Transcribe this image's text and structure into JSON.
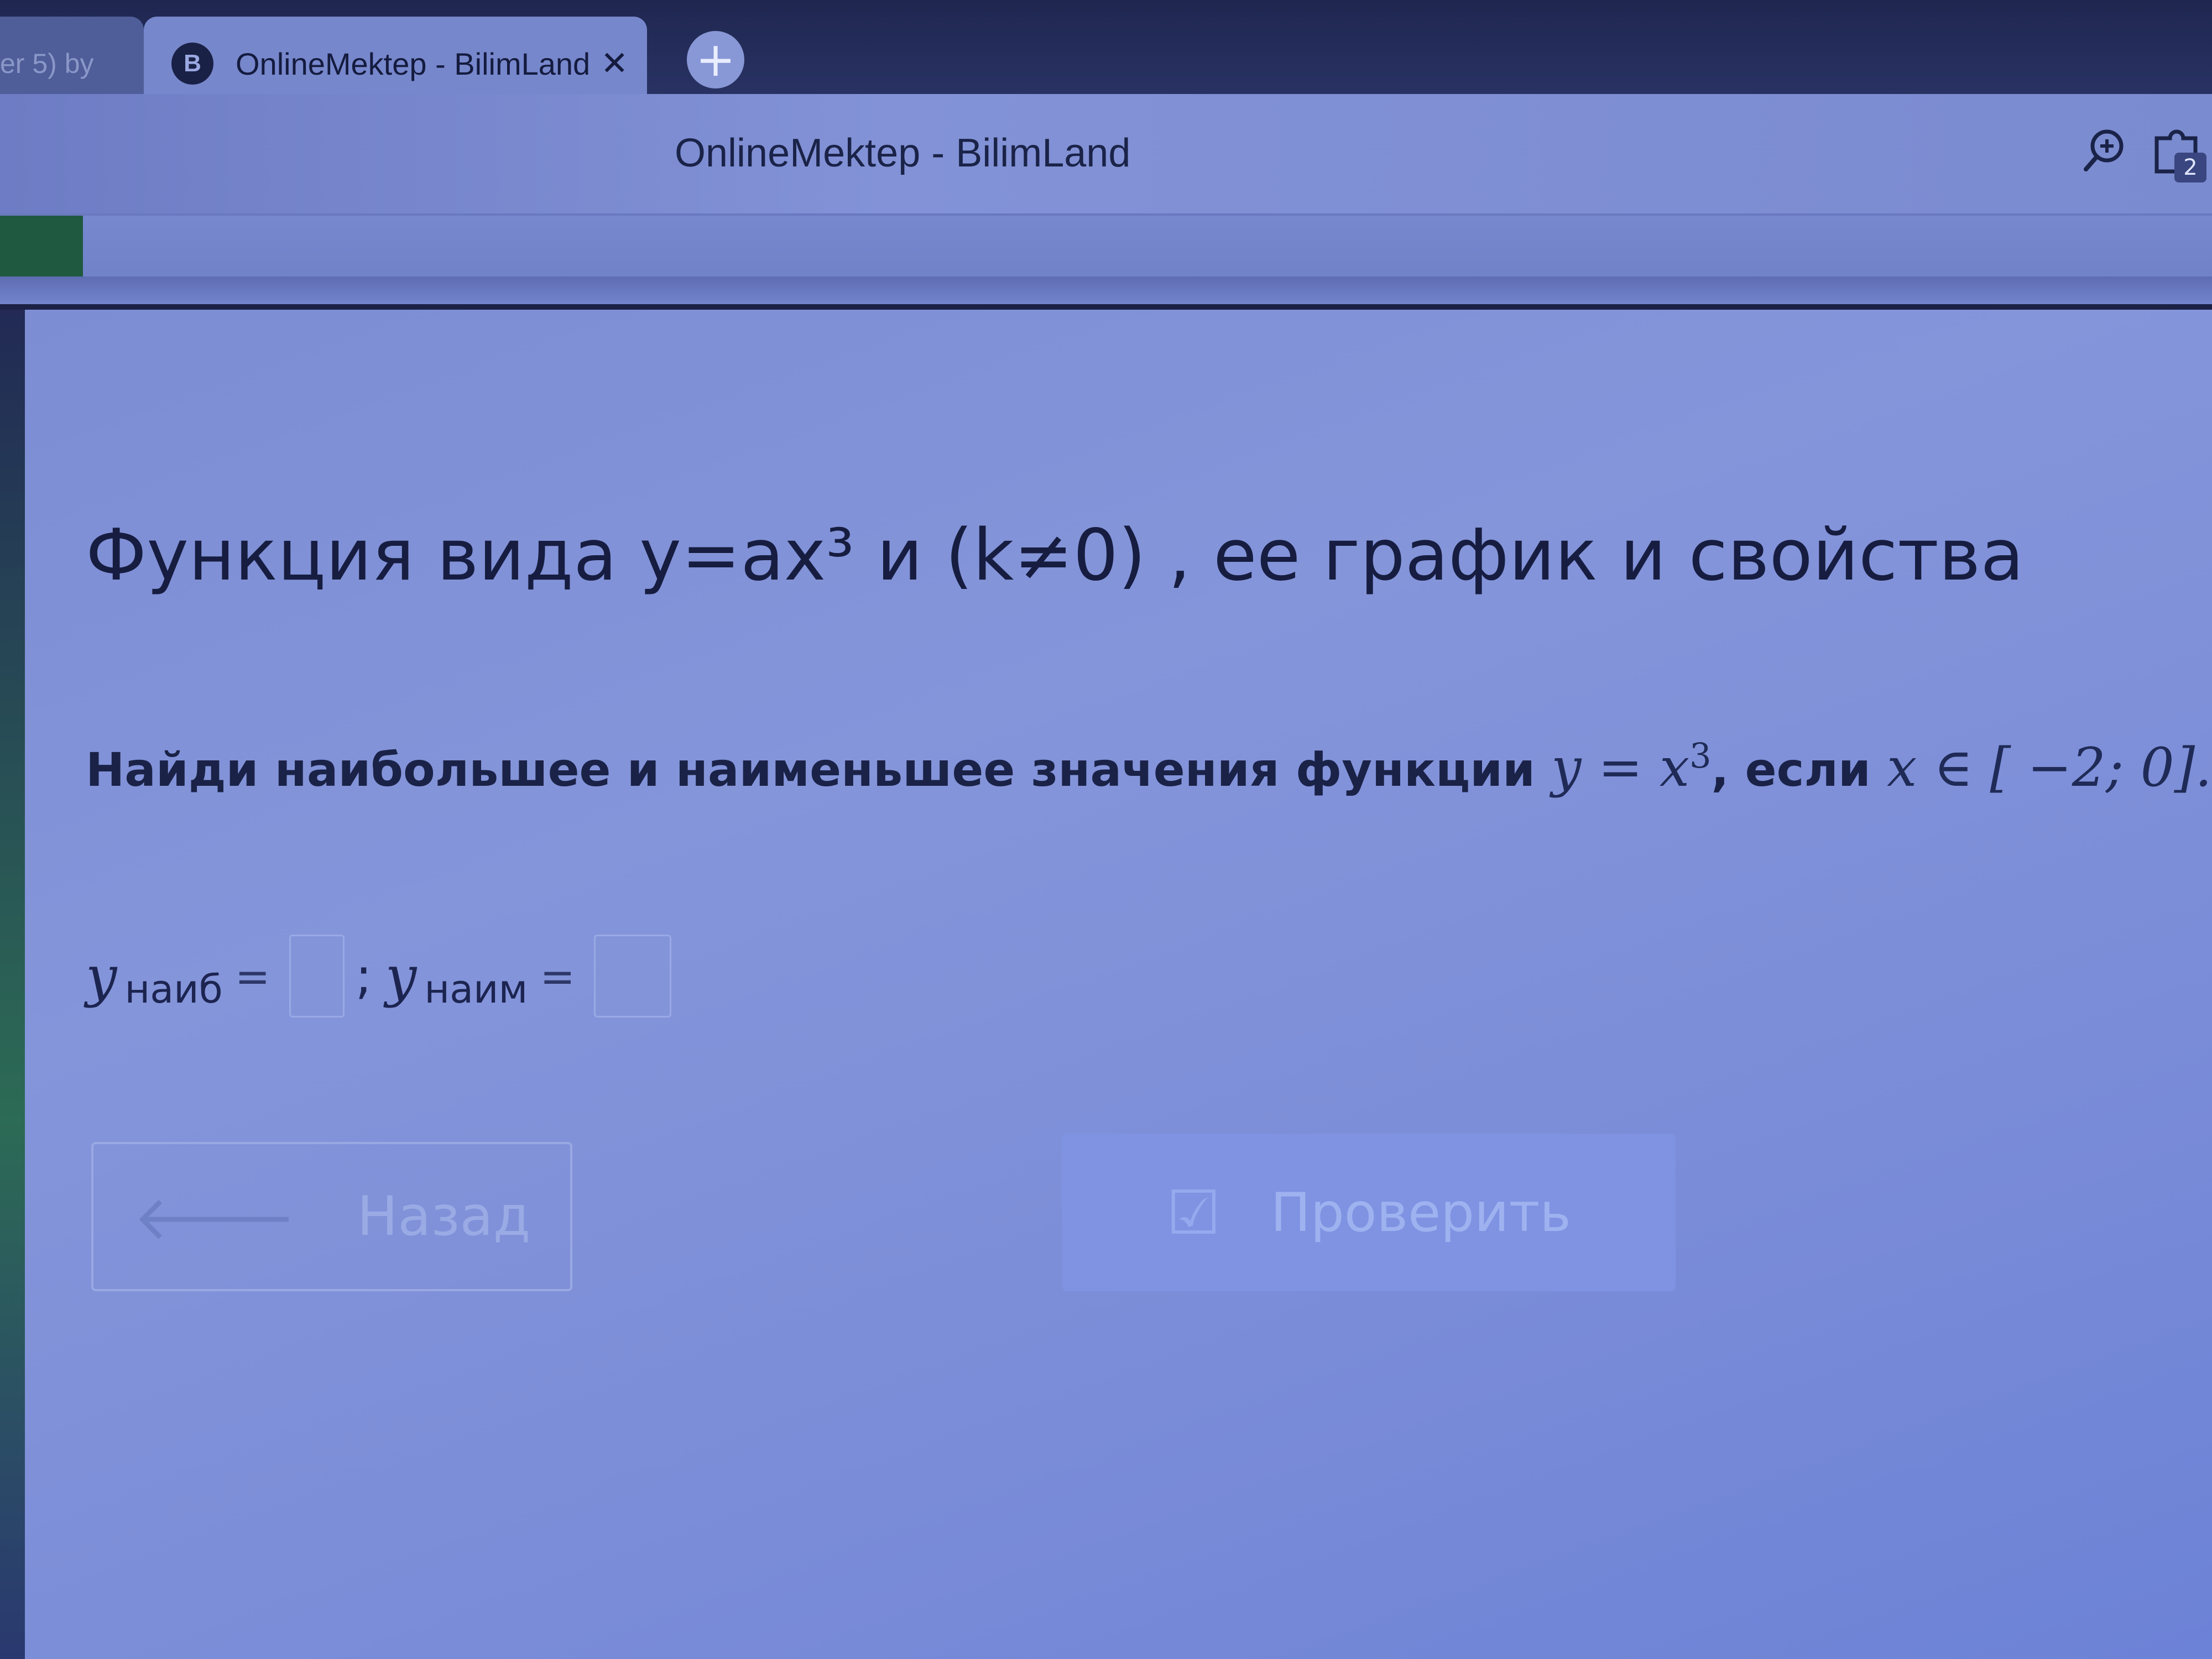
{
  "browser": {
    "tabs": [
      {
        "title": "er 5) by",
        "active": false
      },
      {
        "title": "OnlineMektep - BilimLand",
        "active": true
      }
    ],
    "favicon_glyph": "B",
    "close_glyph": "✕",
    "new_tab_glyph": "+",
    "window_title": "OnlineMektep - BilimLand",
    "extension_badge": "2"
  },
  "lesson": {
    "title": "Функция вида y=ax³ и (k≠0) , ее график и свойства"
  },
  "task": {
    "text": "Найди наибольшее и наименьшее значения функции",
    "function": "y = x",
    "exponent": "3",
    "condition_word": ", если",
    "interval": "x ∈ [ −2; 0].",
    "max_var": "y",
    "max_sub": "наиб",
    "min_var": "y",
    "min_sub": "наим",
    "equals": "=",
    "separator": ";",
    "max_value": "",
    "min_value": ""
  },
  "buttons": {
    "back_label": "Назад",
    "back_icon": "arrow-left-icon",
    "check_label": "Проверить",
    "check_icon": "checkbox-icon"
  },
  "colors": {
    "accent": "#7f93e2",
    "text": "#161d40"
  }
}
